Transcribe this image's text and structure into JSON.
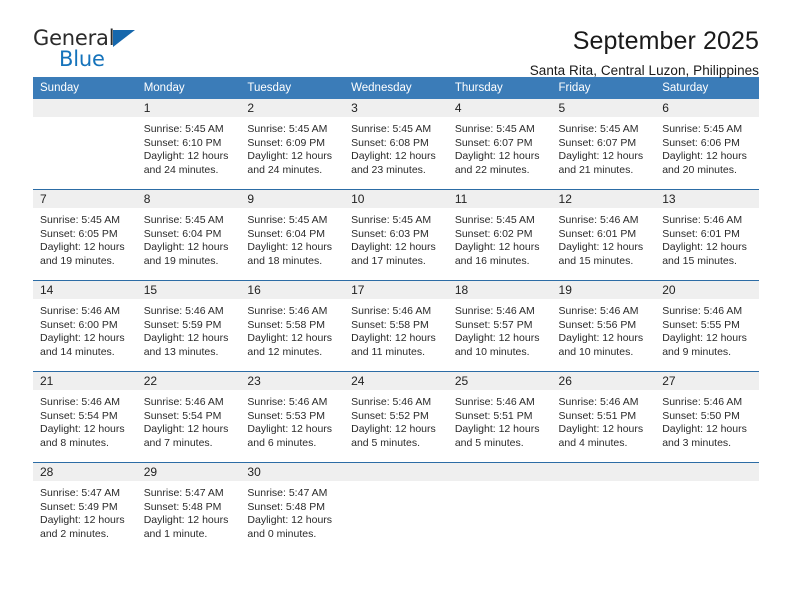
{
  "brand": {
    "name_part1": "General",
    "name_part2": "Blue",
    "triangle_color": "#1667ac",
    "blue_color": "#1573bb"
  },
  "header": {
    "title": "September 2025",
    "subtitle": "Santa Rita, Central Luzon, Philippines"
  },
  "theme": {
    "header_bg": "#3b7cb8",
    "row_divider": "#2c6ca5",
    "daynum_band_bg": "#efefef"
  },
  "weekday_headers": [
    "Sunday",
    "Monday",
    "Tuesday",
    "Wednesday",
    "Thursday",
    "Friday",
    "Saturday"
  ],
  "labels": {
    "sunrise_prefix": "Sunrise:",
    "sunset_prefix": "Sunset:",
    "daylight_prefix": "Daylight:"
  },
  "weeks": [
    [
      {
        "day": "",
        "sunrise": "",
        "sunset": "",
        "daylight_line1": "",
        "daylight_line2": ""
      },
      {
        "day": "1",
        "sunrise": "Sunrise: 5:45 AM",
        "sunset": "Sunset: 6:10 PM",
        "daylight_line1": "Daylight: 12 hours",
        "daylight_line2": "and 24 minutes."
      },
      {
        "day": "2",
        "sunrise": "Sunrise: 5:45 AM",
        "sunset": "Sunset: 6:09 PM",
        "daylight_line1": "Daylight: 12 hours",
        "daylight_line2": "and 24 minutes."
      },
      {
        "day": "3",
        "sunrise": "Sunrise: 5:45 AM",
        "sunset": "Sunset: 6:08 PM",
        "daylight_line1": "Daylight: 12 hours",
        "daylight_line2": "and 23 minutes."
      },
      {
        "day": "4",
        "sunrise": "Sunrise: 5:45 AM",
        "sunset": "Sunset: 6:07 PM",
        "daylight_line1": "Daylight: 12 hours",
        "daylight_line2": "and 22 minutes."
      },
      {
        "day": "5",
        "sunrise": "Sunrise: 5:45 AM",
        "sunset": "Sunset: 6:07 PM",
        "daylight_line1": "Daylight: 12 hours",
        "daylight_line2": "and 21 minutes."
      },
      {
        "day": "6",
        "sunrise": "Sunrise: 5:45 AM",
        "sunset": "Sunset: 6:06 PM",
        "daylight_line1": "Daylight: 12 hours",
        "daylight_line2": "and 20 minutes."
      }
    ],
    [
      {
        "day": "7",
        "sunrise": "Sunrise: 5:45 AM",
        "sunset": "Sunset: 6:05 PM",
        "daylight_line1": "Daylight: 12 hours",
        "daylight_line2": "and 19 minutes."
      },
      {
        "day": "8",
        "sunrise": "Sunrise: 5:45 AM",
        "sunset": "Sunset: 6:04 PM",
        "daylight_line1": "Daylight: 12 hours",
        "daylight_line2": "and 19 minutes."
      },
      {
        "day": "9",
        "sunrise": "Sunrise: 5:45 AM",
        "sunset": "Sunset: 6:04 PM",
        "daylight_line1": "Daylight: 12 hours",
        "daylight_line2": "and 18 minutes."
      },
      {
        "day": "10",
        "sunrise": "Sunrise: 5:45 AM",
        "sunset": "Sunset: 6:03 PM",
        "daylight_line1": "Daylight: 12 hours",
        "daylight_line2": "and 17 minutes."
      },
      {
        "day": "11",
        "sunrise": "Sunrise: 5:45 AM",
        "sunset": "Sunset: 6:02 PM",
        "daylight_line1": "Daylight: 12 hours",
        "daylight_line2": "and 16 minutes."
      },
      {
        "day": "12",
        "sunrise": "Sunrise: 5:46 AM",
        "sunset": "Sunset: 6:01 PM",
        "daylight_line1": "Daylight: 12 hours",
        "daylight_line2": "and 15 minutes."
      },
      {
        "day": "13",
        "sunrise": "Sunrise: 5:46 AM",
        "sunset": "Sunset: 6:01 PM",
        "daylight_line1": "Daylight: 12 hours",
        "daylight_line2": "and 15 minutes."
      }
    ],
    [
      {
        "day": "14",
        "sunrise": "Sunrise: 5:46 AM",
        "sunset": "Sunset: 6:00 PM",
        "daylight_line1": "Daylight: 12 hours",
        "daylight_line2": "and 14 minutes."
      },
      {
        "day": "15",
        "sunrise": "Sunrise: 5:46 AM",
        "sunset": "Sunset: 5:59 PM",
        "daylight_line1": "Daylight: 12 hours",
        "daylight_line2": "and 13 minutes."
      },
      {
        "day": "16",
        "sunrise": "Sunrise: 5:46 AM",
        "sunset": "Sunset: 5:58 PM",
        "daylight_line1": "Daylight: 12 hours",
        "daylight_line2": "and 12 minutes."
      },
      {
        "day": "17",
        "sunrise": "Sunrise: 5:46 AM",
        "sunset": "Sunset: 5:58 PM",
        "daylight_line1": "Daylight: 12 hours",
        "daylight_line2": "and 11 minutes."
      },
      {
        "day": "18",
        "sunrise": "Sunrise: 5:46 AM",
        "sunset": "Sunset: 5:57 PM",
        "daylight_line1": "Daylight: 12 hours",
        "daylight_line2": "and 10 minutes."
      },
      {
        "day": "19",
        "sunrise": "Sunrise: 5:46 AM",
        "sunset": "Sunset: 5:56 PM",
        "daylight_line1": "Daylight: 12 hours",
        "daylight_line2": "and 10 minutes."
      },
      {
        "day": "20",
        "sunrise": "Sunrise: 5:46 AM",
        "sunset": "Sunset: 5:55 PM",
        "daylight_line1": "Daylight: 12 hours",
        "daylight_line2": "and 9 minutes."
      }
    ],
    [
      {
        "day": "21",
        "sunrise": "Sunrise: 5:46 AM",
        "sunset": "Sunset: 5:54 PM",
        "daylight_line1": "Daylight: 12 hours",
        "daylight_line2": "and 8 minutes."
      },
      {
        "day": "22",
        "sunrise": "Sunrise: 5:46 AM",
        "sunset": "Sunset: 5:54 PM",
        "daylight_line1": "Daylight: 12 hours",
        "daylight_line2": "and 7 minutes."
      },
      {
        "day": "23",
        "sunrise": "Sunrise: 5:46 AM",
        "sunset": "Sunset: 5:53 PM",
        "daylight_line1": "Daylight: 12 hours",
        "daylight_line2": "and 6 minutes."
      },
      {
        "day": "24",
        "sunrise": "Sunrise: 5:46 AM",
        "sunset": "Sunset: 5:52 PM",
        "daylight_line1": "Daylight: 12 hours",
        "daylight_line2": "and 5 minutes."
      },
      {
        "day": "25",
        "sunrise": "Sunrise: 5:46 AM",
        "sunset": "Sunset: 5:51 PM",
        "daylight_line1": "Daylight: 12 hours",
        "daylight_line2": "and 5 minutes."
      },
      {
        "day": "26",
        "sunrise": "Sunrise: 5:46 AM",
        "sunset": "Sunset: 5:51 PM",
        "daylight_line1": "Daylight: 12 hours",
        "daylight_line2": "and 4 minutes."
      },
      {
        "day": "27",
        "sunrise": "Sunrise: 5:46 AM",
        "sunset": "Sunset: 5:50 PM",
        "daylight_line1": "Daylight: 12 hours",
        "daylight_line2": "and 3 minutes."
      }
    ],
    [
      {
        "day": "28",
        "sunrise": "Sunrise: 5:47 AM",
        "sunset": "Sunset: 5:49 PM",
        "daylight_line1": "Daylight: 12 hours",
        "daylight_line2": "and 2 minutes."
      },
      {
        "day": "29",
        "sunrise": "Sunrise: 5:47 AM",
        "sunset": "Sunset: 5:48 PM",
        "daylight_line1": "Daylight: 12 hours",
        "daylight_line2": "and 1 minute."
      },
      {
        "day": "30",
        "sunrise": "Sunrise: 5:47 AM",
        "sunset": "Sunset: 5:48 PM",
        "daylight_line1": "Daylight: 12 hours",
        "daylight_line2": "and 0 minutes."
      },
      {
        "day": "",
        "sunrise": "",
        "sunset": "",
        "daylight_line1": "",
        "daylight_line2": ""
      },
      {
        "day": "",
        "sunrise": "",
        "sunset": "",
        "daylight_line1": "",
        "daylight_line2": ""
      },
      {
        "day": "",
        "sunrise": "",
        "sunset": "",
        "daylight_line1": "",
        "daylight_line2": ""
      },
      {
        "day": "",
        "sunrise": "",
        "sunset": "",
        "daylight_line1": "",
        "daylight_line2": ""
      }
    ]
  ]
}
